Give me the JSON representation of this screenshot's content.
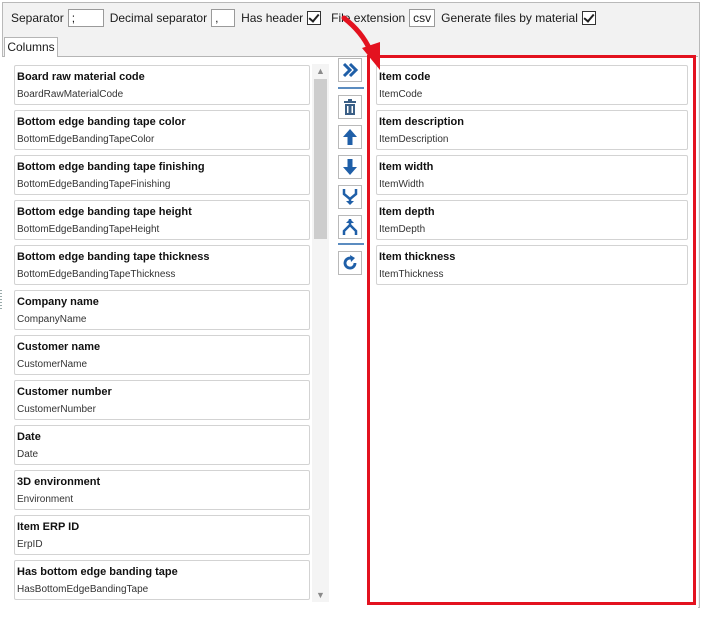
{
  "toolbar": {
    "separator_label": "Separator",
    "separator_value": ";",
    "decimal_label": "Decimal separator",
    "decimal_value": ",",
    "has_header_label": "Has header",
    "file_ext_label": "File extension",
    "file_ext_value": "csv",
    "generate_label": "Generate files by material"
  },
  "tabs": {
    "columns": "Columns"
  },
  "available_columns": [
    {
      "title": "Board raw material code",
      "field": "BoardRawMaterialCode"
    },
    {
      "title": "Bottom edge banding tape color",
      "field": "BottomEdgeBandingTapeColor"
    },
    {
      "title": "Bottom edge banding tape finishing",
      "field": "BottomEdgeBandingTapeFinishing"
    },
    {
      "title": "Bottom edge banding tape height",
      "field": "BottomEdgeBandingTapeHeight"
    },
    {
      "title": "Bottom edge banding tape thickness",
      "field": "BottomEdgeBandingTapeThickness"
    },
    {
      "title": "Company name",
      "field": "CompanyName"
    },
    {
      "title": "Customer name",
      "field": "CustomerName"
    },
    {
      "title": "Customer number",
      "field": "CustomerNumber"
    },
    {
      "title": "Date",
      "field": "Date"
    },
    {
      "title": "3D environment",
      "field": "Environment"
    },
    {
      "title": "Item ERP ID",
      "field": "ErpID"
    },
    {
      "title": "Has bottom edge banding tape",
      "field": "HasBottomEdgeBandingTape"
    }
  ],
  "selected_columns": [
    {
      "title": "Item code",
      "field": "ItemCode"
    },
    {
      "title": "Item description",
      "field": "ItemDescription"
    },
    {
      "title": "Item width",
      "field": "ItemWidth"
    },
    {
      "title": "Item depth",
      "field": "ItemDepth"
    },
    {
      "title": "Item thickness",
      "field": "ItemThickness"
    }
  ],
  "icons": {
    "add_all": "double-chevron-right-icon",
    "delete": "trash-icon",
    "move_up": "arrow-up-icon",
    "move_down": "arrow-down-icon",
    "merge": "merge-icon",
    "split": "split-icon",
    "refresh": "refresh-icon"
  },
  "colors": {
    "highlight": "#e3121f",
    "accent": "#1f5fa8"
  },
  "options": {
    "has_header": true,
    "generate_by_material": true
  }
}
